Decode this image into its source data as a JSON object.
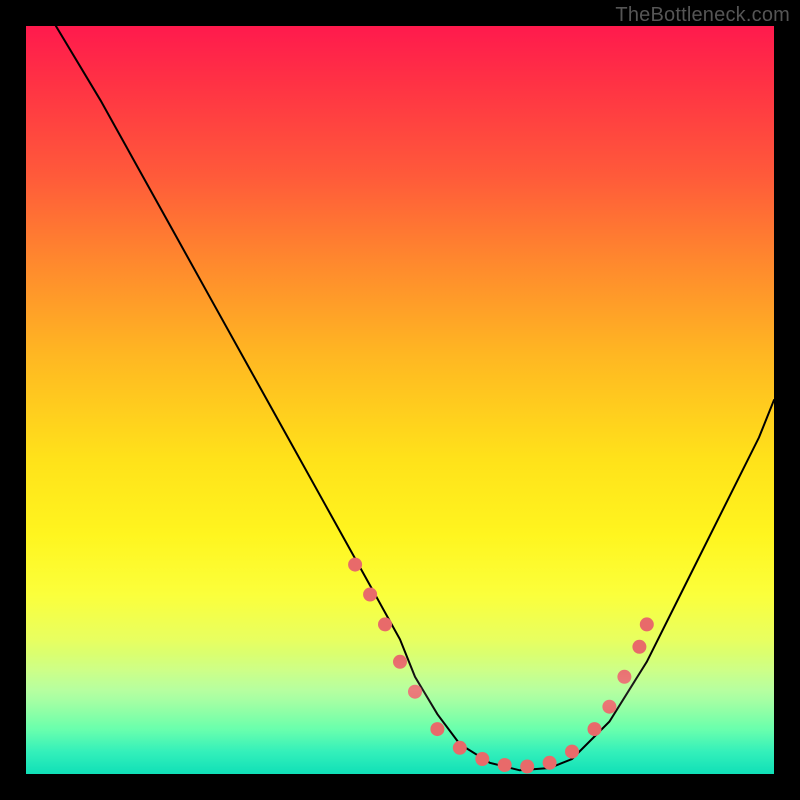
{
  "watermark": "TheBottleneck.com",
  "chart_data": {
    "type": "line",
    "title": "",
    "xlabel": "",
    "ylabel": "",
    "xlim": [
      0,
      100
    ],
    "ylim": [
      0,
      100
    ],
    "grid": false,
    "series": [
      {
        "name": "curve",
        "stroke": "#000000",
        "stroke_width": 2,
        "x": [
          4,
          10,
          15,
          20,
          25,
          30,
          35,
          40,
          45,
          50,
          52,
          55,
          58,
          62,
          66,
          70,
          73,
          78,
          83,
          88,
          93,
          98,
          100
        ],
        "y": [
          100,
          90,
          81,
          72,
          63,
          54,
          45,
          36,
          27,
          18,
          13,
          8,
          4,
          1.5,
          0.5,
          0.8,
          2,
          7,
          15,
          25,
          35,
          45,
          50
        ]
      }
    ],
    "markers": {
      "color": "#e86a6a",
      "radius": 7,
      "points": [
        {
          "x": 44,
          "y": 28
        },
        {
          "x": 46,
          "y": 24
        },
        {
          "x": 48,
          "y": 20
        },
        {
          "x": 50,
          "y": 15
        },
        {
          "x": 52,
          "y": 11
        },
        {
          "x": 55,
          "y": 6
        },
        {
          "x": 58,
          "y": 3.5
        },
        {
          "x": 61,
          "y": 2
        },
        {
          "x": 64,
          "y": 1.2
        },
        {
          "x": 67,
          "y": 1
        },
        {
          "x": 70,
          "y": 1.5
        },
        {
          "x": 73,
          "y": 3
        },
        {
          "x": 76,
          "y": 6
        },
        {
          "x": 78,
          "y": 9
        },
        {
          "x": 80,
          "y": 13
        },
        {
          "x": 82,
          "y": 17
        },
        {
          "x": 83,
          "y": 20
        }
      ]
    }
  }
}
